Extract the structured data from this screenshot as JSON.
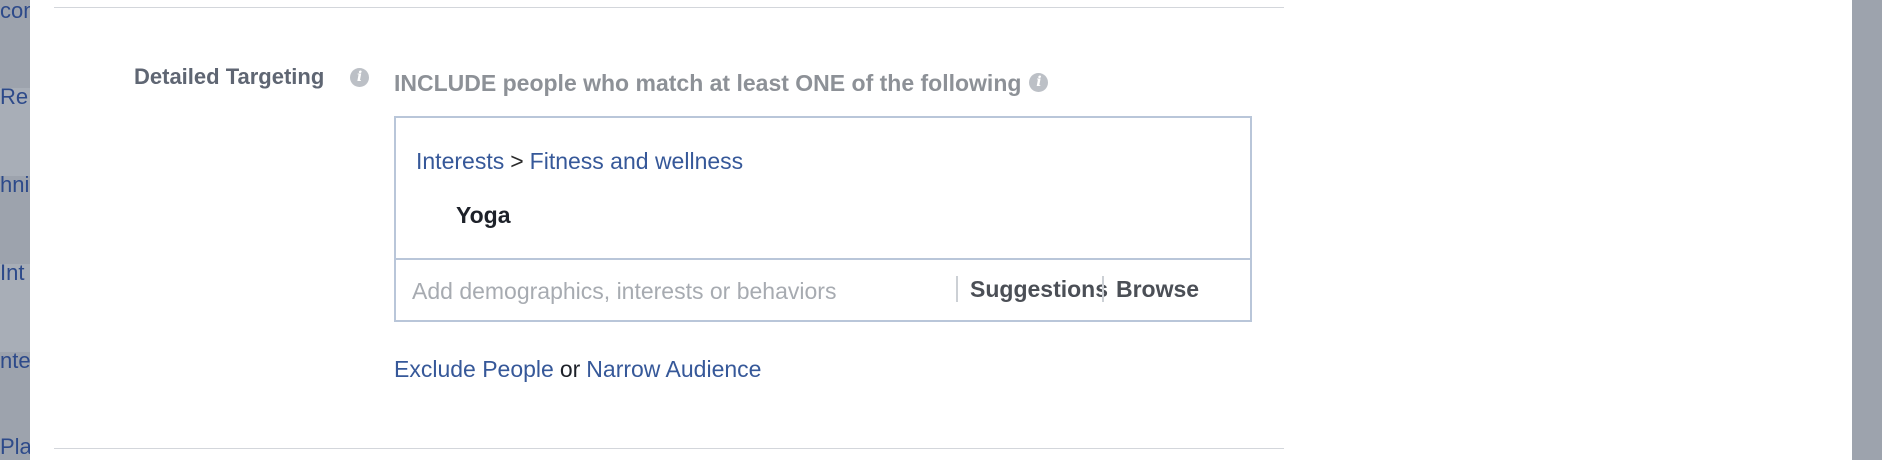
{
  "background": {
    "fragments": [
      "com",
      "Re",
      "hni",
      "Int",
      "nte",
      "Plat"
    ]
  },
  "detailed_targeting": {
    "label": "Detailed Targeting",
    "include_text": "INCLUDE people who match at least ONE of the following",
    "breadcrumb": {
      "category": "Interests",
      "separator": ">",
      "subcategory": "Fitness and wellness"
    },
    "selected_item": "Yoga",
    "search": {
      "placeholder": "Add demographics, interests or behaviors",
      "value": ""
    },
    "suggestions_label": "Suggestions",
    "browse_label": "Browse",
    "exclude_label": "Exclude People",
    "or_label": "or",
    "narrow_label": "Narrow Audience"
  },
  "colors": {
    "link": "#365899",
    "label_gray": "#5f6673",
    "box_border": "#b9c6d9"
  },
  "icons": {
    "info": "info-icon"
  }
}
